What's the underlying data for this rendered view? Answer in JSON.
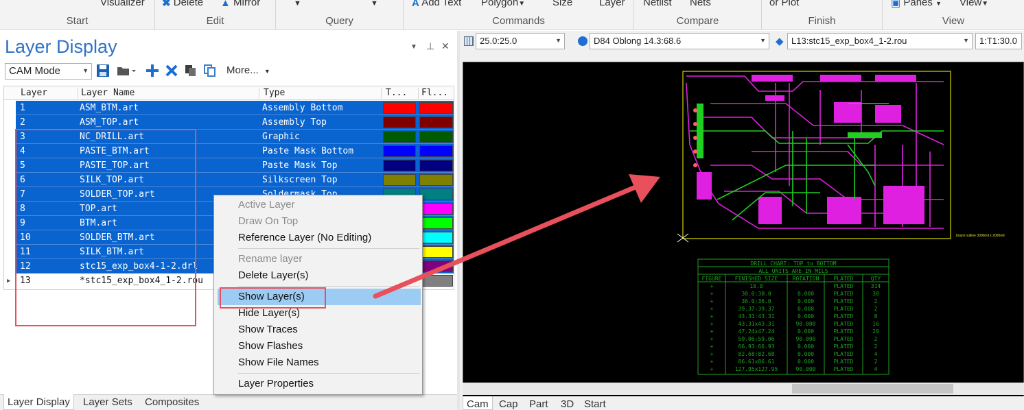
{
  "ribbon": {
    "groups": [
      {
        "caption": "Start",
        "buttons": [
          "Visualizer"
        ]
      },
      {
        "caption": "Edit",
        "buttons": [
          "Delete",
          "Mirror"
        ]
      },
      {
        "caption": "Query",
        "buttons": []
      },
      {
        "caption": "Commands",
        "buttons": [
          "Add Text",
          "Polygon",
          "Size",
          "Layer"
        ]
      },
      {
        "caption": "Compare",
        "buttons": [
          "Netlist",
          "Nets"
        ]
      },
      {
        "caption": "Finish",
        "buttons": [
          "or Plot"
        ]
      },
      {
        "caption": "View",
        "buttons": [
          "Panes",
          "View"
        ]
      }
    ]
  },
  "layer_panel": {
    "title": "Layer Display",
    "mode": "CAM Mode",
    "more": "More...",
    "columns": [
      "Layer",
      "Layer Name",
      "Type",
      "T...",
      "Fl..."
    ],
    "rows": [
      {
        "num": "1",
        "name": "ASM_BTM.art",
        "type": "Assembly Bottom",
        "color": "#ff0000",
        "selected": true
      },
      {
        "num": "2",
        "name": "ASM_TOP.art",
        "type": "Assembly Top",
        "color": "#800000",
        "selected": true
      },
      {
        "num": "3",
        "name": "NC_DRILL.art",
        "type": "Graphic",
        "color": "#005a00",
        "selected": true
      },
      {
        "num": "4",
        "name": "PASTE_BTM.art",
        "type": "Paste Mask Bottom",
        "color": "#0000ff",
        "selected": true
      },
      {
        "num": "5",
        "name": "PASTE_TOP.art",
        "type": "Paste Mask Top",
        "color": "#000080",
        "selected": true
      },
      {
        "num": "6",
        "name": "SILK_TOP.art",
        "type": "Silkscreen Top",
        "color": "#808000",
        "selected": true
      },
      {
        "num": "7",
        "name": "SOLDER_TOP.art",
        "type": "Soldermask Top",
        "color": "#008080",
        "selected": true
      },
      {
        "num": "8",
        "name": "TOP.art",
        "type": "",
        "color": "#ff00ff",
        "selected": true
      },
      {
        "num": "9",
        "name": "BTM.art",
        "type": "",
        "color": "#00ff00",
        "selected": true
      },
      {
        "num": "10",
        "name": "SOLDER_BTM.art",
        "type": "",
        "color": "#00ffff",
        "selected": true
      },
      {
        "num": "11",
        "name": "SILK_BTM.art",
        "type": "",
        "color": "#ffff00",
        "selected": true
      },
      {
        "num": "12",
        "name": "stc15_exp_box4-1-2.drl",
        "type": "",
        "color": "#800080",
        "selected": true
      },
      {
        "num": "13",
        "name": "*stc15_exp_box4_1-2.rou",
        "type": "",
        "color": "#808080",
        "selected": false
      }
    ],
    "tabs": [
      "Layer Display",
      "Layer Sets",
      "Composites"
    ]
  },
  "context_menu": {
    "items": [
      {
        "label": "Active Layer",
        "disabled": true
      },
      {
        "label": "Draw On Top",
        "disabled": true
      },
      {
        "label": "Reference Layer (No Editing)",
        "disabled": false
      },
      {
        "label": "Rename layer",
        "disabled": true
      },
      {
        "label": "Delete Layer(s)",
        "disabled": false
      },
      {
        "label": "Show Layer(s)",
        "disabled": false,
        "highlighted": true
      },
      {
        "label": "Hide Layer(s)",
        "disabled": false
      },
      {
        "label": "Show Traces",
        "disabled": false
      },
      {
        "label": "Show Flashes",
        "disabled": false
      },
      {
        "label": "Show File Names",
        "disabled": false
      },
      {
        "label": "Layer Properties",
        "disabled": false
      }
    ]
  },
  "view_toolbar": {
    "grid": "25.0:25.0",
    "aperture": "D84  Oblong 14.3:68.6",
    "layer": "L13:stc15_exp_box4_1-2.rou",
    "tool": "1:T1:30.0"
  },
  "drill_chart": {
    "title": "DRILL CHART: TOP to BOTTOM",
    "subtitle": "ALL UNITS ARE IN MILS",
    "headers": [
      "FIGURE",
      "FINISHED_SIZE",
      "ROTATION",
      "PLATED",
      "QTY"
    ],
    "rows": [
      [
        "+",
        "10.0",
        "",
        "PLATED",
        "314"
      ],
      [
        "+",
        "30.0:30.0",
        "0.000",
        "PLATED",
        "30"
      ],
      [
        "+",
        "36.0:36.0",
        "0.000",
        "PLATED",
        "2"
      ],
      [
        "+",
        "39.37:39.37",
        "0.000",
        "PLATED",
        "2"
      ],
      [
        "+",
        "43.31:43.31",
        "0.000",
        "PLATED",
        "8"
      ],
      [
        "+",
        "43.31x43.31",
        "90.000",
        "PLATED",
        "16"
      ],
      [
        "+",
        "47.24x47.24",
        "0.000",
        "PLATED",
        "20"
      ],
      [
        "+",
        "59.06:59.06",
        "90.000",
        "PLATED",
        "2"
      ],
      [
        "+",
        "66.93:66.93",
        "0.000",
        "PLATED",
        "2"
      ],
      [
        "+",
        "82.68:82.68",
        "0.000",
        "PLATED",
        "4"
      ],
      [
        "+",
        "86.61x86.61",
        "0.000",
        "PLATED",
        "2"
      ],
      [
        "+",
        "127.95x127.95",
        "90.000",
        "PLATED",
        "4"
      ]
    ]
  },
  "board_note": "board outline 3000mil x 2000mil",
  "view_tabs": [
    "Cam",
    "Cap",
    "Part",
    "3D",
    "Start"
  ],
  "colors": {
    "accent": "#2e72c5",
    "selection": "#0a64d0",
    "annotation": "#e8505b",
    "menu_highlight": "#9ccbf4"
  }
}
